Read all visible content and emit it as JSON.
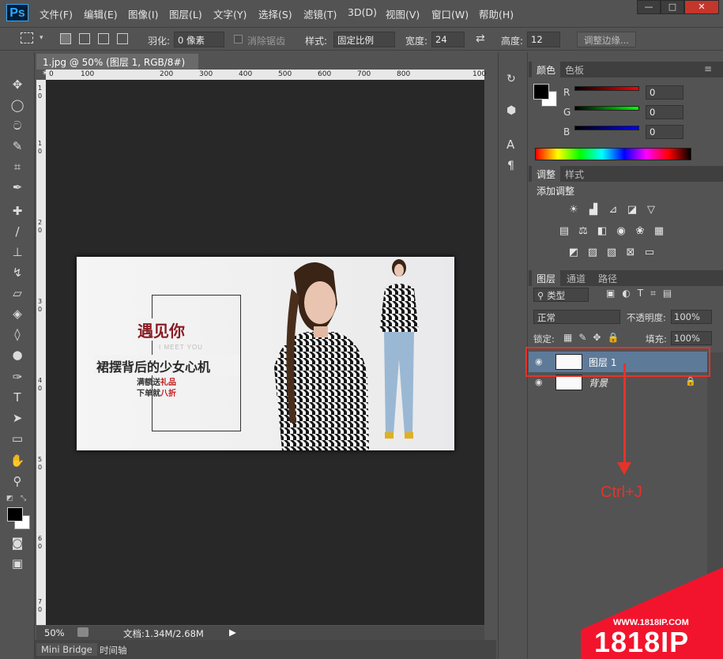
{
  "app": {
    "logo": "Ps"
  },
  "menu": {
    "items": [
      "文件(F)",
      "编辑(E)",
      "图像(I)",
      "图层(L)",
      "文字(Y)",
      "选择(S)",
      "滤镜(T)",
      "3D(D)",
      "视图(V)",
      "窗口(W)",
      "帮助(H)"
    ]
  },
  "window_controls": {
    "minimize": "—",
    "maximize": "□",
    "close": "✕"
  },
  "options": {
    "feather_label": "羽化:",
    "feather_value": "0 像素",
    "antialias_label": "消除锯齿",
    "style_label": "样式:",
    "style_value": "固定比例",
    "width_label": "宽度:",
    "width_value": "24",
    "height_label": "高度:",
    "height_value": "12",
    "refine_edge": "调整边缘..."
  },
  "document": {
    "tab_title": "1.jpg @ 50% (图层 1, RGB/8#) *",
    "tab_close": "×",
    "ruler_top": [
      "0",
      "100",
      "200",
      "300",
      "400",
      "500",
      "600",
      "700",
      "800",
      "100"
    ],
    "ruler_left": [
      "1",
      "0",
      "1",
      "0",
      "2",
      "0",
      "3",
      "0",
      "4",
      "0",
      "5",
      "0",
      "6",
      "0",
      "7",
      "0"
    ],
    "zoom": "50%",
    "doc_info": "文档:1.34M/2.68M"
  },
  "banner": {
    "title": "遇见你",
    "subtitle": "I MEET YOU",
    "headline": "裙摆背后的少女心机",
    "line1_a": "满额送",
    "line1_b": "礼品",
    "line2_a": "下单就",
    "line2_b": "八折"
  },
  "bottom_tabs": [
    "Mini Bridge",
    "时间轴"
  ],
  "color_panel": {
    "tabs": [
      "颜色",
      "色板"
    ],
    "r_label": "R",
    "g_label": "G",
    "b_label": "B",
    "r_value": "0",
    "g_value": "0",
    "b_value": "0",
    "foreground": "#000000",
    "background": "#ffffff"
  },
  "adjust_panel": {
    "tabs": [
      "调整",
      "样式"
    ],
    "title": "添加调整"
  },
  "layers_panel": {
    "tabs": [
      "图层",
      "通道",
      "路径"
    ],
    "filter_label": "类型",
    "blend_mode": "正常",
    "opacity_label": "不透明度:",
    "opacity_value": "100%",
    "lock_label": "锁定:",
    "fill_label": "填充:",
    "fill_value": "100%",
    "layers": [
      {
        "name": "图层 1",
        "selected": true
      },
      {
        "name": "背景",
        "locked": true
      }
    ]
  },
  "annotation": {
    "shortcut": "Ctrl+J",
    "color": "#e5332a"
  },
  "watermark": {
    "site": "WWW.1818IP.COM",
    "brand": "1818IP"
  }
}
